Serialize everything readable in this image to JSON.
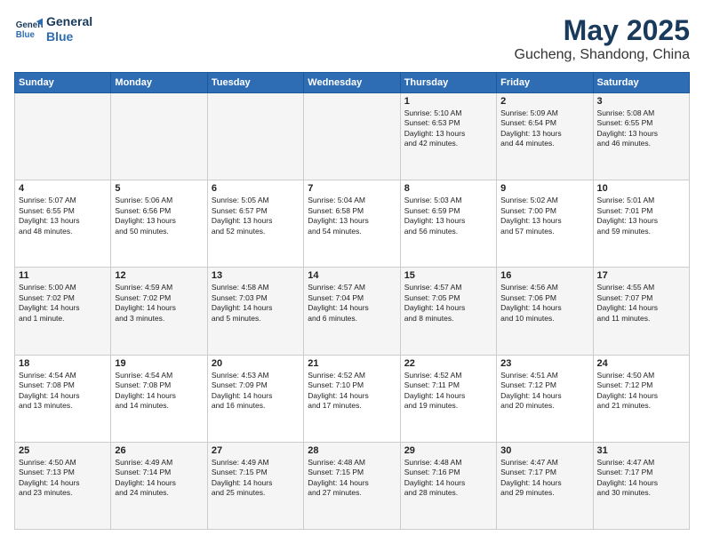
{
  "header": {
    "logo_line1": "General",
    "logo_line2": "Blue",
    "month": "May 2025",
    "location": "Gucheng, Shandong, China"
  },
  "weekdays": [
    "Sunday",
    "Monday",
    "Tuesday",
    "Wednesday",
    "Thursday",
    "Friday",
    "Saturday"
  ],
  "weeks": [
    [
      {
        "day": "",
        "info": ""
      },
      {
        "day": "",
        "info": ""
      },
      {
        "day": "",
        "info": ""
      },
      {
        "day": "",
        "info": ""
      },
      {
        "day": "1",
        "info": "Sunrise: 5:10 AM\nSunset: 6:53 PM\nDaylight: 13 hours\nand 42 minutes."
      },
      {
        "day": "2",
        "info": "Sunrise: 5:09 AM\nSunset: 6:54 PM\nDaylight: 13 hours\nand 44 minutes."
      },
      {
        "day": "3",
        "info": "Sunrise: 5:08 AM\nSunset: 6:55 PM\nDaylight: 13 hours\nand 46 minutes."
      }
    ],
    [
      {
        "day": "4",
        "info": "Sunrise: 5:07 AM\nSunset: 6:55 PM\nDaylight: 13 hours\nand 48 minutes."
      },
      {
        "day": "5",
        "info": "Sunrise: 5:06 AM\nSunset: 6:56 PM\nDaylight: 13 hours\nand 50 minutes."
      },
      {
        "day": "6",
        "info": "Sunrise: 5:05 AM\nSunset: 6:57 PM\nDaylight: 13 hours\nand 52 minutes."
      },
      {
        "day": "7",
        "info": "Sunrise: 5:04 AM\nSunset: 6:58 PM\nDaylight: 13 hours\nand 54 minutes."
      },
      {
        "day": "8",
        "info": "Sunrise: 5:03 AM\nSunset: 6:59 PM\nDaylight: 13 hours\nand 56 minutes."
      },
      {
        "day": "9",
        "info": "Sunrise: 5:02 AM\nSunset: 7:00 PM\nDaylight: 13 hours\nand 57 minutes."
      },
      {
        "day": "10",
        "info": "Sunrise: 5:01 AM\nSunset: 7:01 PM\nDaylight: 13 hours\nand 59 minutes."
      }
    ],
    [
      {
        "day": "11",
        "info": "Sunrise: 5:00 AM\nSunset: 7:02 PM\nDaylight: 14 hours\nand 1 minute."
      },
      {
        "day": "12",
        "info": "Sunrise: 4:59 AM\nSunset: 7:02 PM\nDaylight: 14 hours\nand 3 minutes."
      },
      {
        "day": "13",
        "info": "Sunrise: 4:58 AM\nSunset: 7:03 PM\nDaylight: 14 hours\nand 5 minutes."
      },
      {
        "day": "14",
        "info": "Sunrise: 4:57 AM\nSunset: 7:04 PM\nDaylight: 14 hours\nand 6 minutes."
      },
      {
        "day": "15",
        "info": "Sunrise: 4:57 AM\nSunset: 7:05 PM\nDaylight: 14 hours\nand 8 minutes."
      },
      {
        "day": "16",
        "info": "Sunrise: 4:56 AM\nSunset: 7:06 PM\nDaylight: 14 hours\nand 10 minutes."
      },
      {
        "day": "17",
        "info": "Sunrise: 4:55 AM\nSunset: 7:07 PM\nDaylight: 14 hours\nand 11 minutes."
      }
    ],
    [
      {
        "day": "18",
        "info": "Sunrise: 4:54 AM\nSunset: 7:08 PM\nDaylight: 14 hours\nand 13 minutes."
      },
      {
        "day": "19",
        "info": "Sunrise: 4:54 AM\nSunset: 7:08 PM\nDaylight: 14 hours\nand 14 minutes."
      },
      {
        "day": "20",
        "info": "Sunrise: 4:53 AM\nSunset: 7:09 PM\nDaylight: 14 hours\nand 16 minutes."
      },
      {
        "day": "21",
        "info": "Sunrise: 4:52 AM\nSunset: 7:10 PM\nDaylight: 14 hours\nand 17 minutes."
      },
      {
        "day": "22",
        "info": "Sunrise: 4:52 AM\nSunset: 7:11 PM\nDaylight: 14 hours\nand 19 minutes."
      },
      {
        "day": "23",
        "info": "Sunrise: 4:51 AM\nSunset: 7:12 PM\nDaylight: 14 hours\nand 20 minutes."
      },
      {
        "day": "24",
        "info": "Sunrise: 4:50 AM\nSunset: 7:12 PM\nDaylight: 14 hours\nand 21 minutes."
      }
    ],
    [
      {
        "day": "25",
        "info": "Sunrise: 4:50 AM\nSunset: 7:13 PM\nDaylight: 14 hours\nand 23 minutes."
      },
      {
        "day": "26",
        "info": "Sunrise: 4:49 AM\nSunset: 7:14 PM\nDaylight: 14 hours\nand 24 minutes."
      },
      {
        "day": "27",
        "info": "Sunrise: 4:49 AM\nSunset: 7:15 PM\nDaylight: 14 hours\nand 25 minutes."
      },
      {
        "day": "28",
        "info": "Sunrise: 4:48 AM\nSunset: 7:15 PM\nDaylight: 14 hours\nand 27 minutes."
      },
      {
        "day": "29",
        "info": "Sunrise: 4:48 AM\nSunset: 7:16 PM\nDaylight: 14 hours\nand 28 minutes."
      },
      {
        "day": "30",
        "info": "Sunrise: 4:47 AM\nSunset: 7:17 PM\nDaylight: 14 hours\nand 29 minutes."
      },
      {
        "day": "31",
        "info": "Sunrise: 4:47 AM\nSunset: 7:17 PM\nDaylight: 14 hours\nand 30 minutes."
      }
    ]
  ]
}
